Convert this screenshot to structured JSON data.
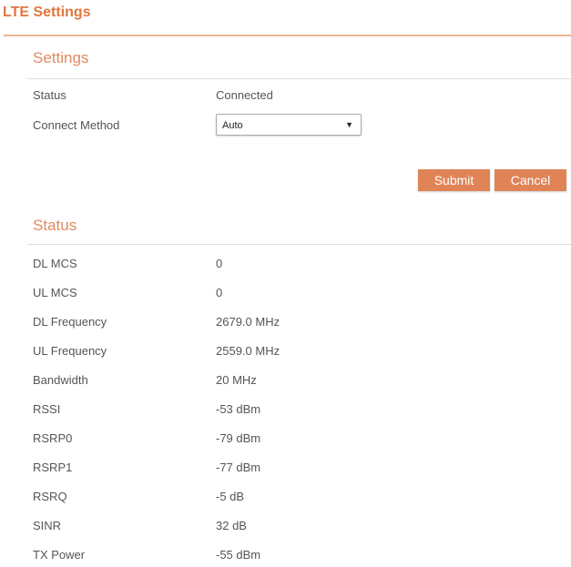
{
  "page_title": "LTE Settings",
  "settings": {
    "heading": "Settings",
    "status_label": "Status",
    "status_value": "Connected",
    "method_label": "Connect Method",
    "method_value": "Auto",
    "submit": "Submit",
    "cancel": "Cancel"
  },
  "status": {
    "heading": "Status",
    "rows": [
      {
        "label": "DL MCS",
        "value": "0"
      },
      {
        "label": "UL MCS",
        "value": "0"
      },
      {
        "label": "DL Frequency",
        "value": "2679.0 MHz"
      },
      {
        "label": "UL Frequency",
        "value": "2559.0 MHz"
      },
      {
        "label": "Bandwidth",
        "value": "20 MHz"
      },
      {
        "label": "RSSI",
        "value": "-53 dBm"
      },
      {
        "label": "RSRP0",
        "value": "-79 dBm"
      },
      {
        "label": "RSRP1",
        "value": "-77 dBm"
      },
      {
        "label": "RSRQ",
        "value": "-5 dB"
      },
      {
        "label": "SINR",
        "value": "32 dB"
      },
      {
        "label": "TX Power",
        "value": "-55 dBm"
      }
    ]
  }
}
